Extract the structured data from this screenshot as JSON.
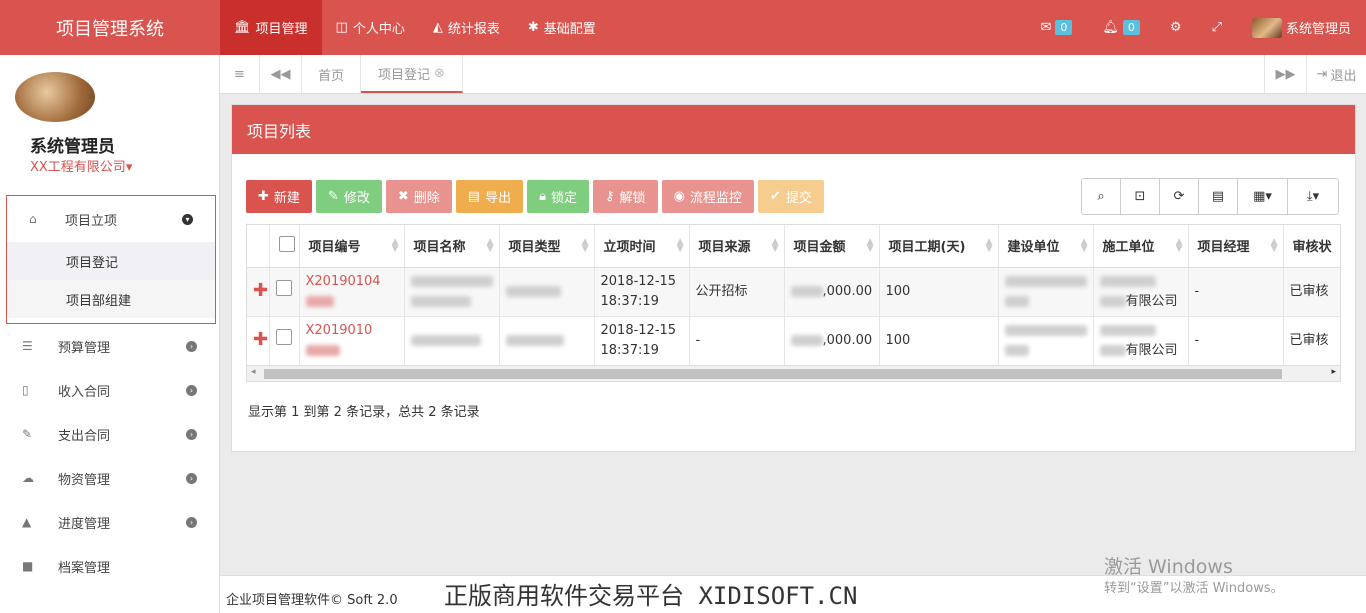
{
  "brand": "项目管理系统",
  "topnav": [
    {
      "label": "项目管理",
      "icon": "bank-icon"
    },
    {
      "label": "个人中心",
      "icon": "columns-icon"
    },
    {
      "label": "统计报表",
      "icon": "area-chart-icon"
    },
    {
      "label": "基础配置",
      "icon": "gear-icon"
    }
  ],
  "topright": {
    "mail_count": "0",
    "bell_count": "0",
    "user": "系统管理员"
  },
  "sidebar": {
    "user_name": "系统管理员",
    "company": "XX工程有限公司",
    "group_label": "项目立项",
    "sub_items": [
      "项目登记",
      "项目部组建"
    ],
    "items": [
      {
        "label": "预算管理",
        "icon": "list-icon"
      },
      {
        "label": "收入合同",
        "icon": "file-icon"
      },
      {
        "label": "支出合同",
        "icon": "edit-icon"
      },
      {
        "label": "物资管理",
        "icon": "cloud-upload-icon"
      },
      {
        "label": "进度管理",
        "icon": "road-icon"
      },
      {
        "label": "档案管理",
        "icon": "folder-icon"
      }
    ]
  },
  "tabs": {
    "home": "首页",
    "current": "项目登记",
    "logout": "退出"
  },
  "panel": {
    "title": "项目列表"
  },
  "toolbar": {
    "new": "新建",
    "edit": "修改",
    "delete": "删除",
    "export": "导出",
    "lock": "锁定",
    "unlock": "解锁",
    "monitor": "流程监控",
    "submit": "提交"
  },
  "colors": {
    "primary": "#d9534f",
    "success": "#5cb85c",
    "warning": "#f0ad4e",
    "info": "#5bc0de"
  },
  "table": {
    "headers": [
      "项目编号",
      "项目名称",
      "项目类型",
      "立项时间",
      "项目来源",
      "项目金额",
      "项目工期(天)",
      "建设单位",
      "施工单位",
      "项目经理",
      "审核状"
    ],
    "rows": [
      {
        "code": "X20190104",
        "date": "2018-12-15",
        "time": "18:37:19",
        "source": "公开招标",
        "amount": ",000.00",
        "period": "100",
        "builder_tail": "有限公司",
        "manager": "-",
        "status": "已审核"
      },
      {
        "code": "X2019010",
        "date": "2018-12-15",
        "time": "18:37:19",
        "source": "-",
        "amount": ",000.00",
        "period": "100",
        "builder_tail": "有限公司",
        "manager": "-",
        "status": "已审核"
      }
    ]
  },
  "pager": "显示第 1 到第 2 条记录，总共 2 条记录",
  "footer": {
    "copyright": "企业项目管理软件© Soft 2.0",
    "watermark": "正版商用软件交易平台 XIDISOFT.CN"
  },
  "windows": {
    "line1": "激活 Windows",
    "line2": "转到“设置”以激活 Windows。"
  }
}
